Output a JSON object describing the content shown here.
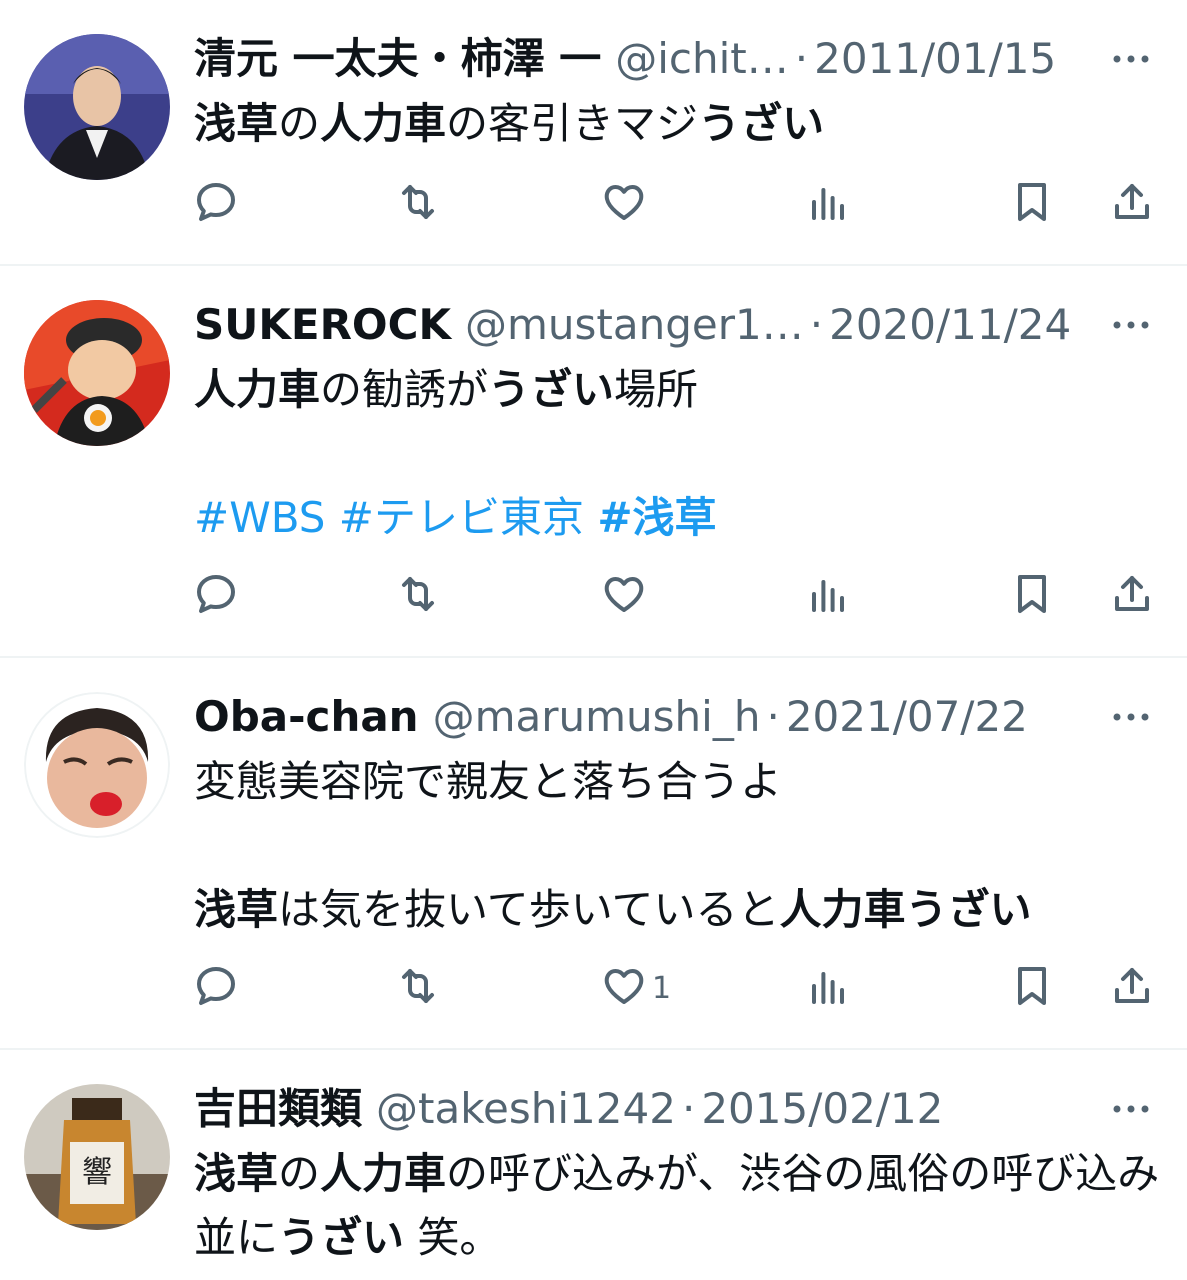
{
  "tweets": [
    {
      "name": "清元 一太夫・柿澤 一",
      "handle": "@ichit…",
      "sep": "·",
      "date": "2011/01/15",
      "body_parts": [
        {
          "t": "浅草",
          "b": true
        },
        {
          "t": "の",
          "b": false
        },
        {
          "t": "人力車",
          "b": true
        },
        {
          "t": "の客引きマジ",
          "b": false
        },
        {
          "t": "うざい",
          "b": true
        }
      ],
      "like_count": ""
    },
    {
      "name": "SUKEROCK",
      "handle": "@mustanger1…",
      "sep": "·",
      "date": "2020/11/24",
      "body_parts": [
        {
          "t": "人力車",
          "b": true
        },
        {
          "t": "の勧誘が",
          "b": false
        },
        {
          "t": "うざい",
          "b": true
        },
        {
          "t": "場所\n\n",
          "b": false
        },
        {
          "t": "#WBS #テレビ東京 ",
          "tag": true
        },
        {
          "t": "#浅草",
          "tag": true,
          "b": true
        }
      ],
      "like_count": ""
    },
    {
      "name": "Oba-chan",
      "handle": "@marumushi_h",
      "sep": "·",
      "date": "2021/07/22",
      "body_parts": [
        {
          "t": "変態美容院で親友と落ち合うよ\n\n",
          "b": false
        },
        {
          "t": "浅草",
          "b": true
        },
        {
          "t": "は気を抜いて歩いていると",
          "b": false
        },
        {
          "t": "人力車うざい",
          "b": true
        }
      ],
      "like_count": "1"
    },
    {
      "name": "吉田類類",
      "handle": "@takeshi1242",
      "sep": "·",
      "date": "2015/02/12",
      "body_parts": [
        {
          "t": "浅草",
          "b": true
        },
        {
          "t": "の",
          "b": false
        },
        {
          "t": "人力車",
          "b": true
        },
        {
          "t": "の呼び込みが、渋谷の風俗の呼び込み並に",
          "b": false
        },
        {
          "t": "うざい",
          "b": true
        },
        {
          "t": " 笑。",
          "b": false
        }
      ],
      "like_count": ""
    }
  ],
  "icons": [
    "more-icon",
    "reply-icon",
    "retweet-icon",
    "like-icon",
    "views-icon",
    "bookmark-icon",
    "share-icon"
  ],
  "colors": {
    "text": "#0f1419",
    "secondary": "#536471",
    "link": "#1d9bf0",
    "divider": "#eff3f4"
  }
}
